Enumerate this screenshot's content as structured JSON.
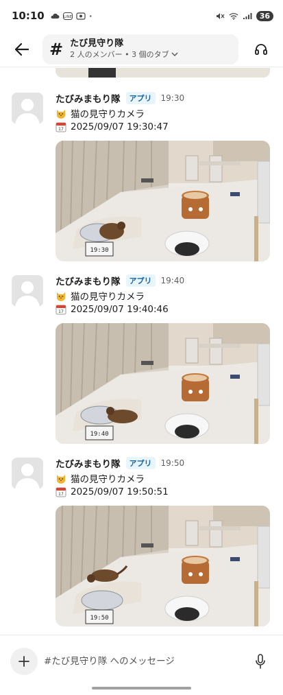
{
  "status_bar": {
    "time": "10:10",
    "battery": "36",
    "icons": [
      "cloud-icon",
      "line-icon",
      "screen-record-icon",
      "dot-icon",
      "mute-icon",
      "wifi-icon",
      "signal-icon",
      "battery-icon"
    ]
  },
  "header": {
    "channel_name": "たび見守り隊",
    "channel_sub": "2 人のメンバー • 3 個のタブ",
    "hash": "#"
  },
  "messages": [
    {
      "sender": "たびみまもり隊",
      "badge": "アプリ",
      "time": "19:30",
      "line1": "猫の見守りカメラ",
      "line2": "2025/09/07 19:30:47",
      "cat_position": "on-mat-right"
    },
    {
      "sender": "たびみまもり隊",
      "badge": "アプリ",
      "time": "19:40",
      "line1": "猫の見守りカメラ",
      "line2": "2025/09/07 19:40:46",
      "cat_position": "lying-on-mat"
    },
    {
      "sender": "たびみまもり隊",
      "badge": "アプリ",
      "time": "19:50",
      "line1": "猫の見守りカメラ",
      "line2": "2025/09/07 19:50:51",
      "cat_position": "walking-left"
    }
  ],
  "composer": {
    "placeholder": "#たび見守り隊 へのメッセージ"
  },
  "colors": {
    "badge_bg": "#e8f5fa",
    "badge_text": "#1264a3",
    "battery_bg": "#3a3a3a"
  }
}
